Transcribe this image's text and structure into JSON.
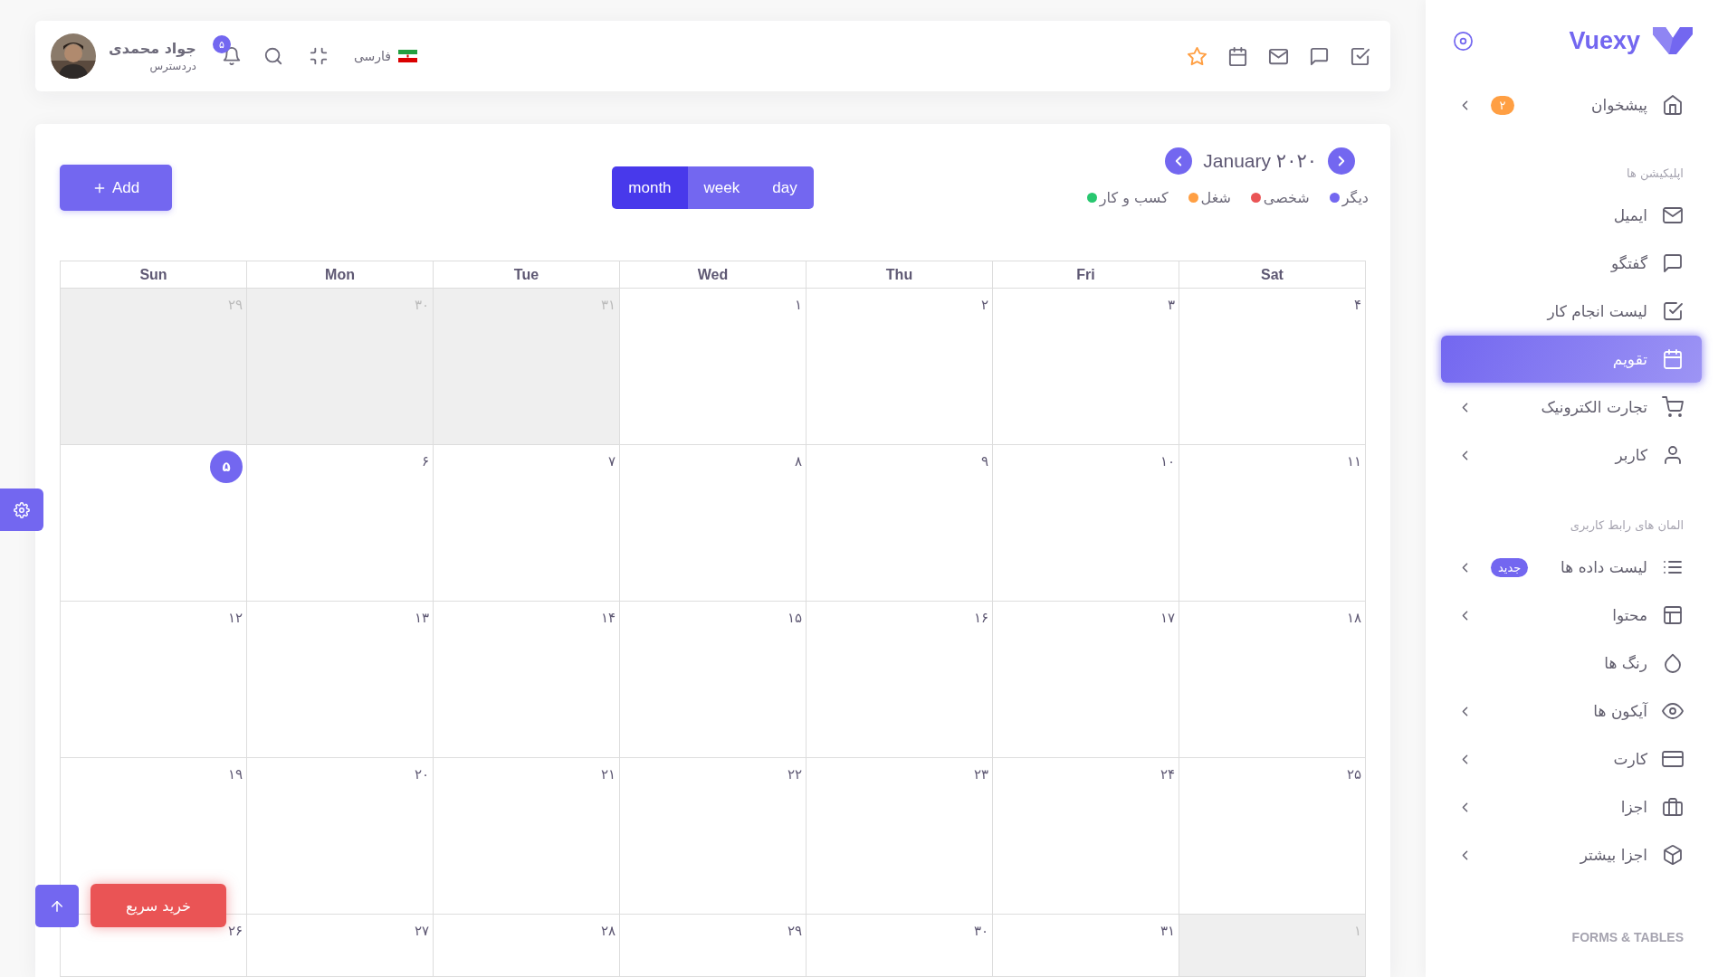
{
  "header": {
    "user": {
      "name": "جواد محمدی",
      "status": "دردسترس"
    },
    "notifications": {
      "count": "۵"
    },
    "language": {
      "label": "فارسی"
    }
  },
  "calendar": {
    "add_button": "Add",
    "title": "January ۲۰۲۰",
    "views": [
      {
        "label": "day",
        "selected": false
      },
      {
        "label": "week",
        "selected": false
      },
      {
        "label": "month",
        "selected": true
      }
    ],
    "legend": [
      {
        "label": "دیگر",
        "color": "#7367f0"
      },
      {
        "label": "شخصی",
        "color": "#ea5455"
      },
      {
        "label": "شغل",
        "color": "#ff9f43"
      },
      {
        "label": "کسب و کار",
        "color": "#28c76f"
      }
    ],
    "weekdays": [
      "Sat",
      "Fri",
      "Thu",
      "Wed",
      "Tue",
      "Mon",
      "Sun"
    ],
    "weeks": [
      [
        {
          "day": "۴",
          "in_month": true,
          "today": false
        },
        {
          "day": "۳",
          "in_month": true,
          "today": false
        },
        {
          "day": "۲",
          "in_month": true,
          "today": false
        },
        {
          "day": "۱",
          "in_month": true,
          "today": false
        },
        {
          "day": "۳۱",
          "in_month": false,
          "today": false
        },
        {
          "day": "۳۰",
          "in_month": false,
          "today": false
        },
        {
          "day": "۲۹",
          "in_month": false,
          "today": false
        }
      ],
      [
        {
          "day": "۱۱",
          "in_month": true,
          "today": false
        },
        {
          "day": "۱۰",
          "in_month": true,
          "today": false
        },
        {
          "day": "۹",
          "in_month": true,
          "today": false
        },
        {
          "day": "۸",
          "in_month": true,
          "today": false
        },
        {
          "day": "۷",
          "in_month": true,
          "today": false
        },
        {
          "day": "۶",
          "in_month": true,
          "today": false
        },
        {
          "day": "۵",
          "in_month": true,
          "today": true
        }
      ],
      [
        {
          "day": "۱۸",
          "in_month": true,
          "today": false
        },
        {
          "day": "۱۷",
          "in_month": true,
          "today": false
        },
        {
          "day": "۱۶",
          "in_month": true,
          "today": false
        },
        {
          "day": "۱۵",
          "in_month": true,
          "today": false
        },
        {
          "day": "۱۴",
          "in_month": true,
          "today": false
        },
        {
          "day": "۱۳",
          "in_month": true,
          "today": false
        },
        {
          "day": "۱۲",
          "in_month": true,
          "today": false
        }
      ],
      [
        {
          "day": "۲۵",
          "in_month": true,
          "today": false
        },
        {
          "day": "۲۴",
          "in_month": true,
          "today": false
        },
        {
          "day": "۲۳",
          "in_month": true,
          "today": false
        },
        {
          "day": "۲۲",
          "in_month": true,
          "today": false
        },
        {
          "day": "۲۱",
          "in_month": true,
          "today": false
        },
        {
          "day": "۲۰",
          "in_month": true,
          "today": false
        },
        {
          "day": "۱۹",
          "in_month": true,
          "today": false
        }
      ],
      [
        {
          "day": "۱",
          "in_month": false,
          "today": false
        },
        {
          "day": "۳۱",
          "in_month": true,
          "today": false
        },
        {
          "day": "۳۰",
          "in_month": true,
          "today": false
        },
        {
          "day": "۲۹",
          "in_month": true,
          "today": false
        },
        {
          "day": "۲۸",
          "in_month": true,
          "today": false
        },
        {
          "day": "۲۷",
          "in_month": true,
          "today": false
        },
        {
          "day": "۲۶",
          "in_month": true,
          "today": false
        }
      ]
    ]
  },
  "sidebar": {
    "brand": "Vuexy",
    "items": [
      {
        "kind": "link",
        "label": "پیشخوان",
        "badge": {
          "text": "۲",
          "color": "#ff9f43"
        },
        "submenu": true,
        "selected": false
      },
      {
        "kind": "section",
        "label": "اپلیکیشن ها"
      },
      {
        "kind": "link",
        "label": "ایمیل",
        "submenu": false,
        "selected": false
      },
      {
        "kind": "link",
        "label": "گفتگو",
        "submenu": false,
        "selected": false
      },
      {
        "kind": "link",
        "label": "لیست انجام کار",
        "submenu": false,
        "selected": false
      },
      {
        "kind": "link",
        "label": "تقویم",
        "submenu": false,
        "selected": true
      },
      {
        "kind": "link",
        "label": "تجارت الکترونیک",
        "submenu": true,
        "selected": false
      },
      {
        "kind": "link",
        "label": "کاربر",
        "submenu": true,
        "selected": false
      },
      {
        "kind": "section",
        "label": "المان های رابط کاربری"
      },
      {
        "kind": "link",
        "label": "لیست داده ها",
        "badge": {
          "text": "جدید",
          "color": "#7367f0"
        },
        "submenu": true,
        "selected": false
      },
      {
        "kind": "link",
        "label": "محتوا",
        "submenu": true,
        "selected": false
      },
      {
        "kind": "link",
        "label": "رنگ ها",
        "submenu": false,
        "selected": false
      },
      {
        "kind": "link",
        "label": "آیکون ها",
        "submenu": true,
        "selected": false
      },
      {
        "kind": "link",
        "label": "کارت",
        "submenu": true,
        "selected": false
      },
      {
        "kind": "link",
        "label": "اجزا",
        "submenu": true,
        "selected": false
      },
      {
        "kind": "link",
        "label": "اجزا بیشتر",
        "submenu": true,
        "selected": false
      },
      {
        "kind": "section",
        "label": "FORMS & TABLES"
      }
    ]
  },
  "quick_buy": "خرید سریع"
}
